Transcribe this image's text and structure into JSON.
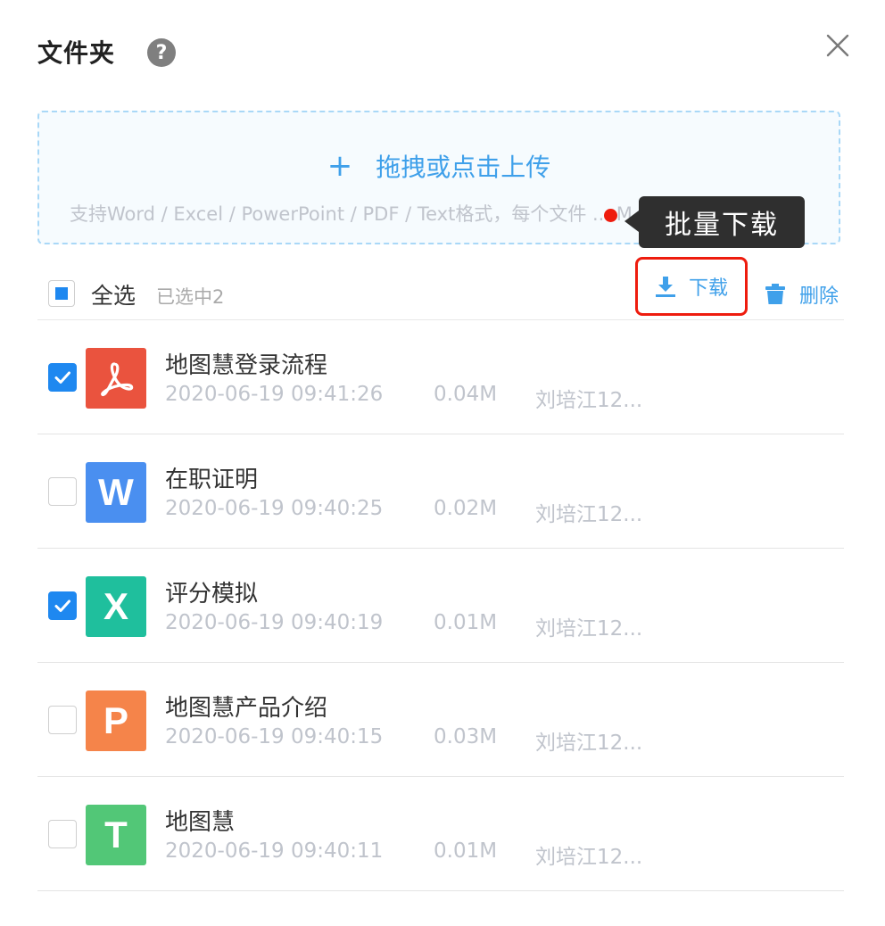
{
  "header": {
    "title": "文件夹",
    "help_glyph": "?"
  },
  "upload": {
    "plus": "+",
    "label": "拖拽或点击上传",
    "hint": "支持Word / Excel / PowerPoint / PDF / Text格式，每个文件 ... M"
  },
  "tooltip": {
    "text": "批量下载"
  },
  "toolbar": {
    "select_all_label": "全选",
    "selected_count": "已选中2",
    "download_label": "下载",
    "delete_label": "删除"
  },
  "files": [
    {
      "name": "地图慧登录流程",
      "time": "2020-06-19 09:41:26",
      "size": "0.04M",
      "owner": "刘培江12...",
      "type": "pdf",
      "icon_glyph": "",
      "icon_color": "#ea533e",
      "checked": true
    },
    {
      "name": "在职证明",
      "time": "2020-06-19 09:40:25",
      "size": "0.02M",
      "owner": "刘培江12...",
      "type": "word",
      "icon_glyph": "W",
      "icon_color": "#4a8ff0",
      "checked": false
    },
    {
      "name": "评分模拟",
      "time": "2020-06-19 09:40:19",
      "size": "0.01M",
      "owner": "刘培江12...",
      "type": "excel",
      "icon_glyph": "X",
      "icon_color": "#1fbf9d",
      "checked": true
    },
    {
      "name": "地图慧产品介绍",
      "time": "2020-06-19 09:40:15",
      "size": "0.03M",
      "owner": "刘培江12...",
      "type": "powerpoint",
      "icon_glyph": "P",
      "icon_color": "#f5844a",
      "checked": false
    },
    {
      "name": "地图慧",
      "time": "2020-06-19 09:40:11",
      "size": "0.01M",
      "owner": "刘培江12...",
      "type": "text",
      "icon_glyph": "T",
      "icon_color": "#52c777",
      "checked": false
    }
  ],
  "colors": {
    "accent": "#3fa0ea",
    "checkbox_blue": "#1e88f0",
    "highlight_red": "#ee1c0e",
    "tooltip_bg": "#2f2f2f"
  },
  "icons": {
    "help": "question-circle-icon",
    "close": "close-icon",
    "upload": "plus-icon",
    "download": "download-icon",
    "delete": "trash-icon",
    "check": "check-icon"
  }
}
